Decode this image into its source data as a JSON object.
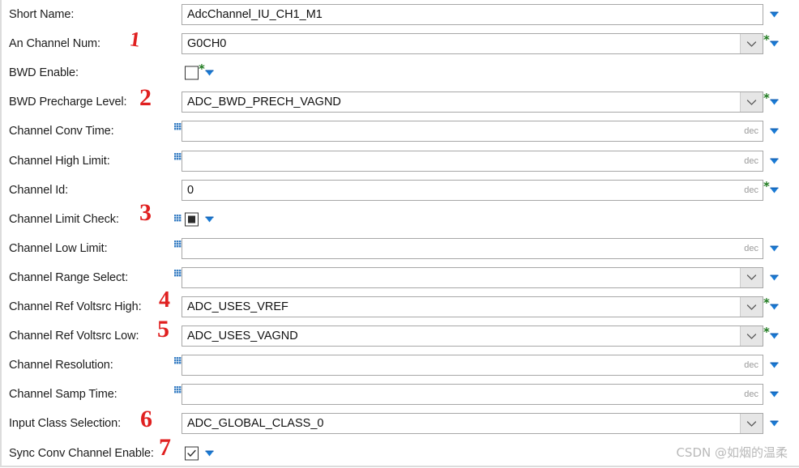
{
  "form": {
    "rows": [
      {
        "label": "Short Name:",
        "type": "text",
        "value": "AdcChannel_IU_CH1_M1",
        "unit": "",
        "combo": false,
        "asterisk": false,
        "handle": false,
        "dropdown_marker": true,
        "annotation": ""
      },
      {
        "label": "An Channel Num:",
        "type": "combo",
        "value": "G0CH0",
        "unit": "",
        "combo": true,
        "asterisk": true,
        "handle": false,
        "dropdown_marker": true,
        "annotation": "1"
      },
      {
        "label": "BWD Enable:",
        "type": "checkbox",
        "value": "unchecked",
        "unit": "",
        "combo": false,
        "asterisk": true,
        "handle": false,
        "dropdown_marker": true,
        "annotation": ""
      },
      {
        "label": "BWD Precharge Level:",
        "type": "combo",
        "value": "ADC_BWD_PRECH_VAGND",
        "unit": "",
        "combo": true,
        "asterisk": true,
        "handle": false,
        "dropdown_marker": true,
        "annotation": "2"
      },
      {
        "label": "Channel Conv Time:",
        "type": "text",
        "value": "",
        "unit": "dec",
        "combo": false,
        "asterisk": false,
        "handle": true,
        "dropdown_marker": true,
        "annotation": ""
      },
      {
        "label": "Channel High Limit:",
        "type": "text",
        "value": "",
        "unit": "dec",
        "combo": false,
        "asterisk": false,
        "handle": true,
        "dropdown_marker": true,
        "annotation": ""
      },
      {
        "label": "Channel Id:",
        "type": "text",
        "value": "0",
        "unit": "dec",
        "combo": false,
        "asterisk": true,
        "handle": false,
        "dropdown_marker": true,
        "annotation": ""
      },
      {
        "label": "Channel Limit Check:",
        "type": "checkbox",
        "value": "indeterminate",
        "unit": "",
        "combo": false,
        "asterisk": false,
        "handle": true,
        "dropdown_marker": true,
        "annotation": "3"
      },
      {
        "label": "Channel Low Limit:",
        "type": "text",
        "value": "",
        "unit": "dec",
        "combo": false,
        "asterisk": false,
        "handle": true,
        "dropdown_marker": true,
        "annotation": ""
      },
      {
        "label": "Channel Range Select:",
        "type": "combo",
        "value": "",
        "unit": "",
        "combo": true,
        "asterisk": false,
        "handle": true,
        "dropdown_marker": true,
        "annotation": ""
      },
      {
        "label": "Channel Ref Voltsrc High:",
        "type": "combo",
        "value": "ADC_USES_VREF",
        "unit": "",
        "combo": true,
        "asterisk": true,
        "handle": false,
        "dropdown_marker": true,
        "annotation": "4"
      },
      {
        "label": "Channel Ref Voltsrc Low:",
        "type": "combo",
        "value": "ADC_USES_VAGND",
        "unit": "",
        "combo": true,
        "asterisk": true,
        "handle": false,
        "dropdown_marker": true,
        "annotation": "5"
      },
      {
        "label": "Channel Resolution:",
        "type": "text",
        "value": "",
        "unit": "dec",
        "combo": false,
        "asterisk": false,
        "handle": true,
        "dropdown_marker": true,
        "annotation": ""
      },
      {
        "label": "Channel Samp Time:",
        "type": "text",
        "value": "",
        "unit": "dec",
        "combo": false,
        "asterisk": false,
        "handle": true,
        "dropdown_marker": true,
        "annotation": ""
      },
      {
        "label": "Input Class Selection:",
        "type": "combo",
        "value": "ADC_GLOBAL_CLASS_0",
        "unit": "",
        "combo": true,
        "asterisk": false,
        "handle": false,
        "dropdown_marker": true,
        "annotation": "6"
      },
      {
        "label": "Sync Conv Channel Enable:",
        "type": "checkbox",
        "value": "checked",
        "unit": "",
        "combo": false,
        "asterisk": false,
        "handle": false,
        "dropdown_marker": true,
        "annotation": "7"
      }
    ]
  },
  "watermark": {
    "text": "CSDN @如烟的温柔"
  },
  "colors": {
    "accent_blue": "#1a7ad4",
    "required_green": "#1f7a1f",
    "annotation_red": "#e02020",
    "field_border": "#a7a7a7",
    "text": "#1c1c1c"
  }
}
